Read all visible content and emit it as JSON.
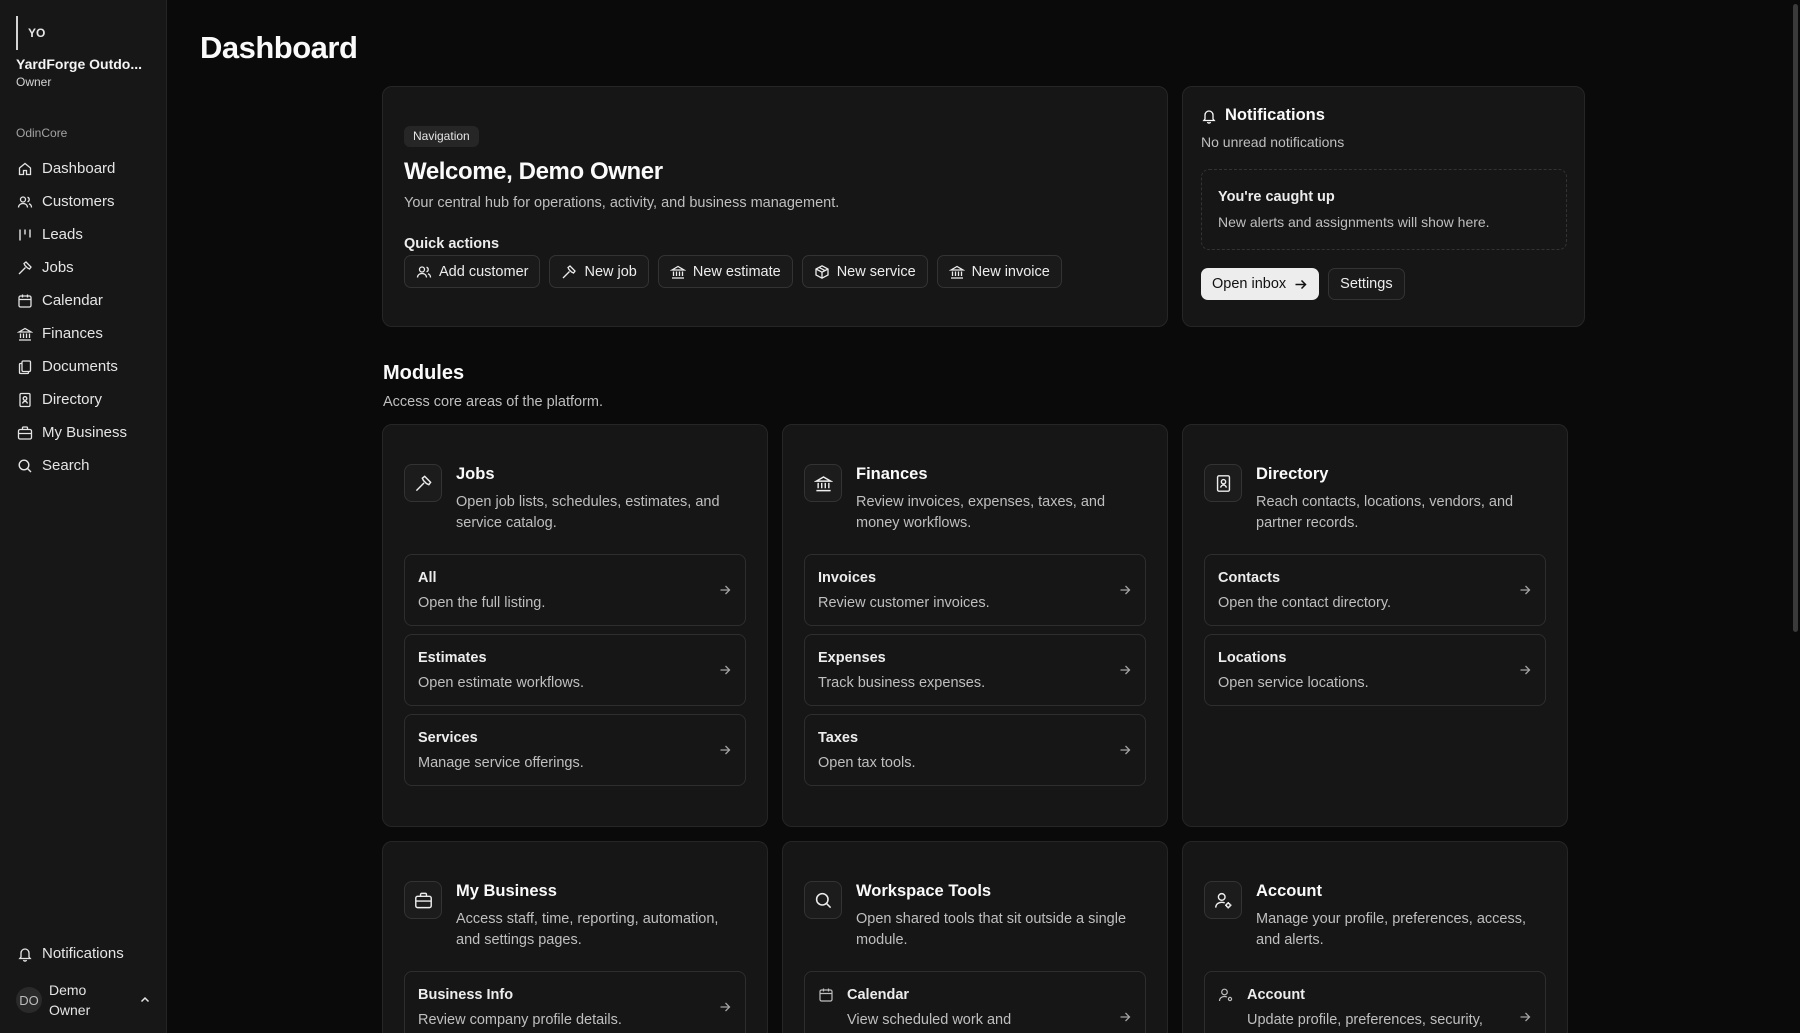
{
  "org": {
    "logo_text": "YO",
    "name": "YardForge Outdo...",
    "role": "Owner"
  },
  "sidebar": {
    "group_label": "OdinCore",
    "items": [
      {
        "label": "Dashboard",
        "icon": "home-icon"
      },
      {
        "label": "Customers",
        "icon": "users-icon"
      },
      {
        "label": "Leads",
        "icon": "kanban-icon"
      },
      {
        "label": "Jobs",
        "icon": "hammer-icon"
      },
      {
        "label": "Calendar",
        "icon": "calendar-icon"
      },
      {
        "label": "Finances",
        "icon": "bank-icon"
      },
      {
        "label": "Documents",
        "icon": "files-icon"
      },
      {
        "label": "Directory",
        "icon": "contact-book-icon"
      },
      {
        "label": "My Business",
        "icon": "briefcase-icon"
      },
      {
        "label": "Search",
        "icon": "search-icon"
      }
    ],
    "notifications_label": "Notifications",
    "user": {
      "initials": "DO",
      "name": "Demo Owner"
    }
  },
  "page": {
    "title": "Dashboard"
  },
  "welcome": {
    "badge": "Navigation",
    "title": "Welcome, Demo Owner",
    "subtitle": "Your central hub for operations, activity, and business management.",
    "quick_actions_label": "Quick actions",
    "quick_actions": [
      {
        "label": "Add customer",
        "icon": "users-icon"
      },
      {
        "label": "New job",
        "icon": "hammer-icon"
      },
      {
        "label": "New estimate",
        "icon": "bank-icon"
      },
      {
        "label": "New service",
        "icon": "package-icon"
      },
      {
        "label": "New invoice",
        "icon": "bank-icon"
      }
    ]
  },
  "notifications": {
    "title": "Notifications",
    "subtitle": "No unread notifications",
    "empty_title": "You're caught up",
    "empty_text": "New alerts and assignments will show here.",
    "open_inbox": "Open inbox",
    "settings": "Settings"
  },
  "modules": {
    "title": "Modules",
    "subtitle": "Access core areas of the platform.",
    "cards": [
      {
        "title": "Jobs",
        "icon": "hammer-icon",
        "description": "Open job lists, schedules, estimates, and service catalog.",
        "links": [
          {
            "title": "All",
            "desc": "Open the full listing."
          },
          {
            "title": "Estimates",
            "desc": "Open estimate workflows."
          },
          {
            "title": "Services",
            "desc": "Manage service offerings."
          }
        ]
      },
      {
        "title": "Finances",
        "icon": "bank-icon",
        "description": "Review invoices, expenses, taxes, and money workflows.",
        "links": [
          {
            "title": "Invoices",
            "desc": "Review customer invoices."
          },
          {
            "title": "Expenses",
            "desc": "Track business expenses."
          },
          {
            "title": "Taxes",
            "desc": "Open tax tools."
          }
        ]
      },
      {
        "title": "Directory",
        "icon": "contact-book-icon",
        "description": "Reach contacts, locations, vendors, and partner records.",
        "links": [
          {
            "title": "Contacts",
            "desc": "Open the contact directory."
          },
          {
            "title": "Locations",
            "desc": "Open service locations."
          }
        ]
      },
      {
        "title": "My Business",
        "icon": "briefcase-icon",
        "description": "Access staff, time, reporting, automation, and settings pages.",
        "links": [
          {
            "title": "Business Info",
            "desc": "Review company profile details."
          }
        ]
      },
      {
        "title": "Workspace Tools",
        "icon": "search-icon",
        "description": "Open shared tools that sit outside a single module.",
        "links": [
          {
            "title": "Calendar",
            "desc": "View scheduled work and",
            "icon": "calendar-icon"
          }
        ]
      },
      {
        "title": "Account",
        "icon": "user-settings-icon",
        "description": "Manage your profile, preferences, access, and alerts.",
        "links": [
          {
            "title": "Account",
            "desc": "Update profile, preferences, security,",
            "icon": "user-settings-icon"
          }
        ]
      }
    ]
  }
}
